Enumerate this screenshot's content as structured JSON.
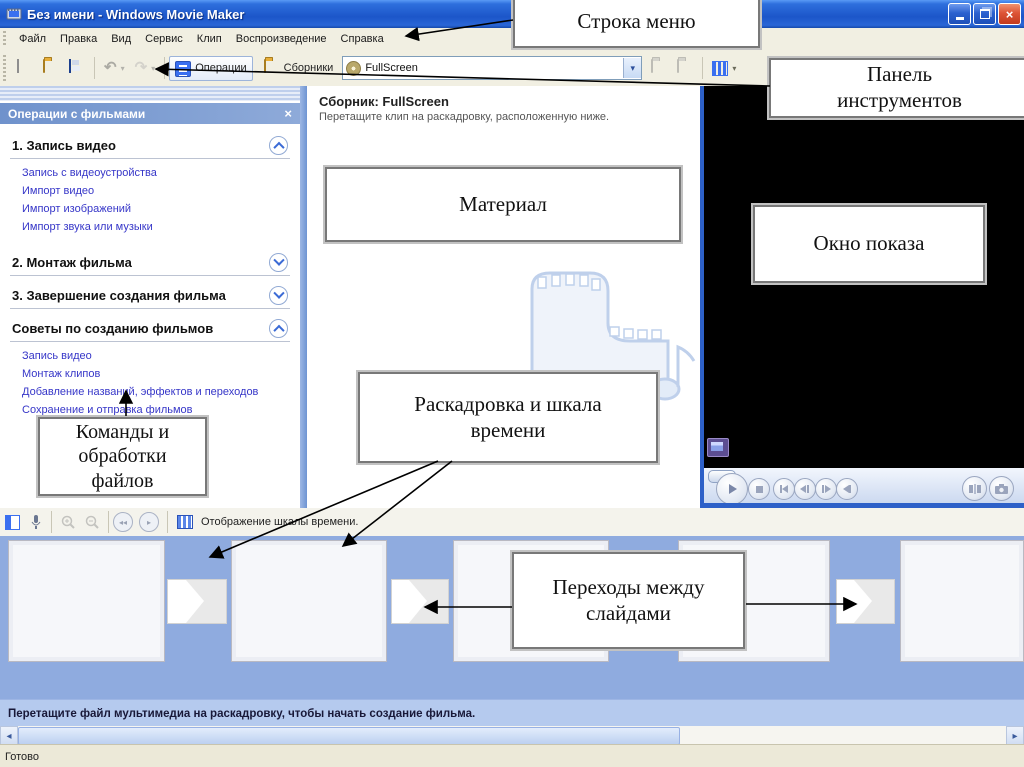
{
  "window": {
    "title": "Без имени - Windows Movie Maker"
  },
  "menu": {
    "items": [
      "Файл",
      "Правка",
      "Вид",
      "Сервис",
      "Клип",
      "Воспроизведение",
      "Справка"
    ]
  },
  "toolbar": {
    "operations_label": "Операции",
    "collections_label": "Сборники",
    "combo_value": "FullScreen"
  },
  "task_pane": {
    "title": "Операции с фильмами",
    "sections": [
      {
        "label": "1. Запись видео",
        "state": "expanded",
        "links": [
          "Запись с видеоустройства",
          "Импорт видео",
          "Импорт изображений",
          "Импорт звука или музыки"
        ]
      },
      {
        "label": "2. Монтаж фильма",
        "state": "collapsed",
        "links": []
      },
      {
        "label": "3. Завершение создания фильма",
        "state": "collapsed",
        "links": []
      },
      {
        "label": "Советы по созданию фильмов",
        "state": "expanded",
        "links": [
          "Запись видео",
          "Монтаж клипов",
          "Добавление названий, эффектов и переходов",
          "Сохранение и отправка фильмов"
        ]
      }
    ]
  },
  "collection": {
    "title": "Сборник: FullScreen",
    "hint": "Перетащите клип на раскадровку, расположенную ниже."
  },
  "storyboard_bar": {
    "timeline_label": "Отображение шкалы времени."
  },
  "storyboard": {
    "hint": "Перетащите файл мультимедиа на раскадровку, чтобы начать создание фильма."
  },
  "status": {
    "text": "Готово"
  },
  "callouts": {
    "menu": "Строка меню",
    "toolbar": "Панель\nинструментов",
    "material": "Материал",
    "preview": "Окно показа",
    "storyboard": "Раскадровка и шкала\nвремени",
    "commands": "Команды и\nобработки\nфайлов",
    "transitions": "Переходы между\nслайдами"
  },
  "glyphs": {
    "close_x": "×",
    "undo": "↶",
    "redo": "↷",
    "caret": "▾",
    "scroll_left": "◂",
    "scroll_right": "▸",
    "rewind": "◂◂",
    "play_small": "▸"
  },
  "colors": {
    "titlebar_blue": "#1c56c9",
    "storyboard_blue": "#8fabdf",
    "link_blue": "#3636c8",
    "status_bg": "#ece9d8",
    "preview_black": "#000000"
  }
}
